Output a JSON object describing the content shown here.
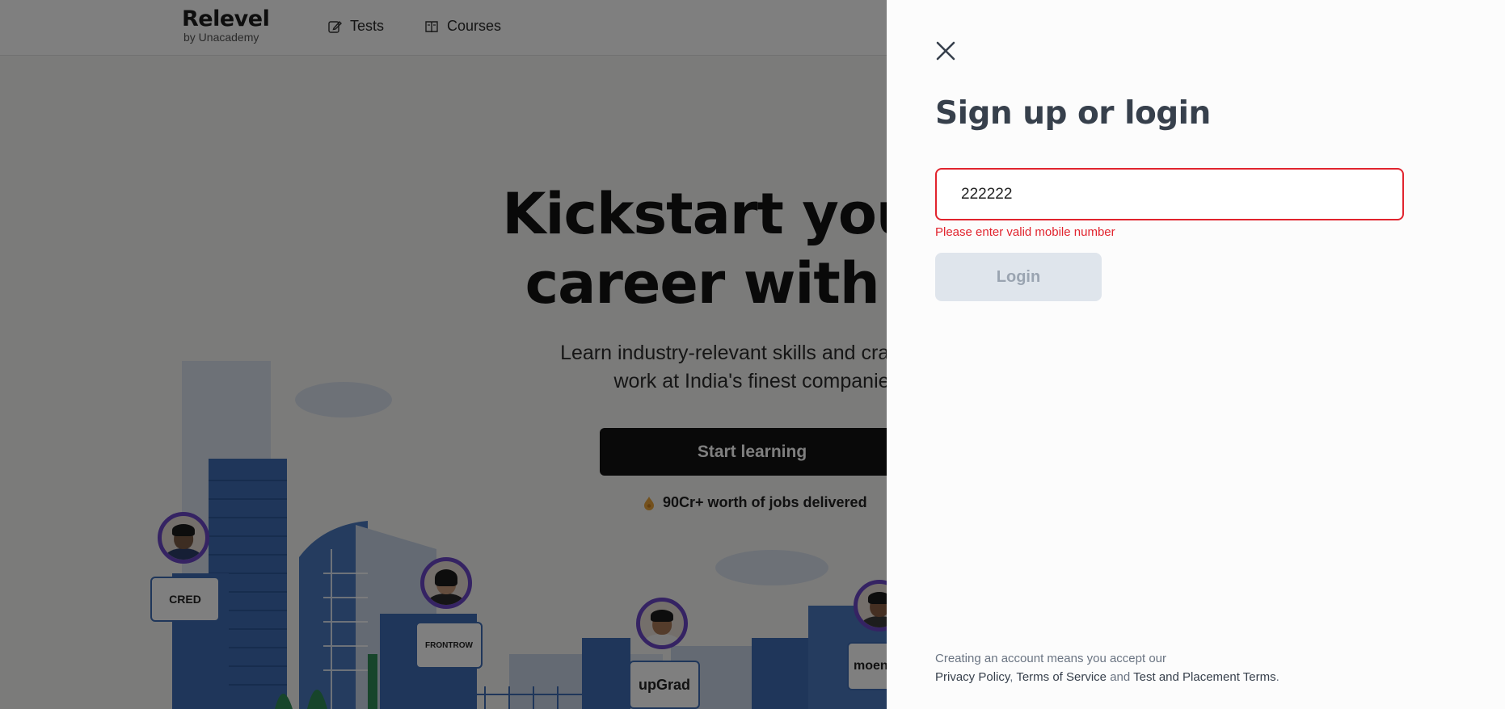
{
  "header": {
    "logo_main": "Relevel",
    "logo_sub": "by Unacademy",
    "nav": [
      {
        "label": "Tests",
        "icon": "edit-icon"
      },
      {
        "label": "Courses",
        "icon": "book-icon"
      }
    ]
  },
  "hero": {
    "title_line1": "Kickstart your d",
    "title_line2": "career with Re",
    "subtitle_line1": "Learn industry-relevant skills and crack the",
    "subtitle_line2": "work at India's finest companie",
    "cta_label": "Start learning",
    "jobs_text": "90Cr+ worth of jobs delivered"
  },
  "companies": [
    "CRED",
    "FRONTROW",
    "upGrad",
    "moeng"
  ],
  "auth": {
    "title": "Sign up or login",
    "phone_value": "222222",
    "error": "Please enter valid mobile number",
    "login_label": "Login",
    "terms_prefix": "Creating an account means you accept our",
    "privacy": "Privacy Policy",
    "comma": ",",
    "tos": "Terms of Service",
    "and": "and",
    "placement": "Test and Placement Terms",
    "period": "."
  },
  "colors": {
    "error": "#e1242e",
    "overlay": "rgba(0,0,0,0.5)",
    "drawer_bg": "#fcfcfc",
    "button_disabled": "#dfe5ec",
    "accent_purple": "#6a47c6"
  }
}
